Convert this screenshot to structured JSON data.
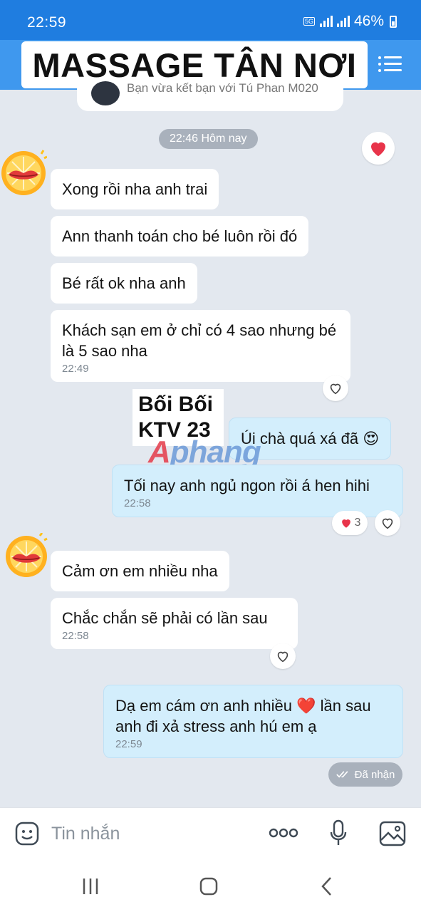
{
  "status_bar": {
    "time": "22:59",
    "network": "5G",
    "battery": "46%"
  },
  "header": {
    "title": "MASSAGE TẬN NƠI",
    "menu_icon": "list-menu-icon"
  },
  "friend_card": {
    "text": "Bạn vừa kết bạn với Tú Phan M020"
  },
  "date_chip": "22:46 Hôm nay",
  "messages": [
    {
      "text": "Xong rồi nha anh trai",
      "time": ""
    },
    {
      "text": "Ann thanh toán cho bé luôn rồi đó",
      "time": ""
    },
    {
      "text": "Bé rất ok nha anh",
      "time": ""
    },
    {
      "text": "Khách sạn em ở chỉ có 4 sao nhưng bé là 5 sao nha",
      "time": "22:49"
    },
    {
      "text": "Úi chà quá xá đã 😍",
      "time": ""
    },
    {
      "text": "Tối nay anh ngủ ngon rồi á hen hihi",
      "time": "22:58"
    },
    {
      "text": "Cảm ơn em nhiều nha",
      "time": ""
    },
    {
      "text": "Chắc chắn sẽ phải có lần sau",
      "time": "22:58"
    },
    {
      "text": "Dạ em cám ơn anh nhiều ❤️ lần sau anh đi xả stress anh hú em ạ",
      "time": "22:59"
    }
  ],
  "reaction_count": "3",
  "delivery_status": "Đã nhận",
  "watermark": {
    "line1": "Bối Bối",
    "line2": "KTV 23",
    "brand": "Aphang"
  },
  "composer": {
    "placeholder": "Tin nhắn"
  },
  "colors": {
    "header": "#3f98ee",
    "status_bar": "#1f7de0",
    "outgoing_bubble": "#d3eefc",
    "incoming_bubble": "#ffffff",
    "background": "#e3e8ef",
    "heart": "#e8344a"
  }
}
